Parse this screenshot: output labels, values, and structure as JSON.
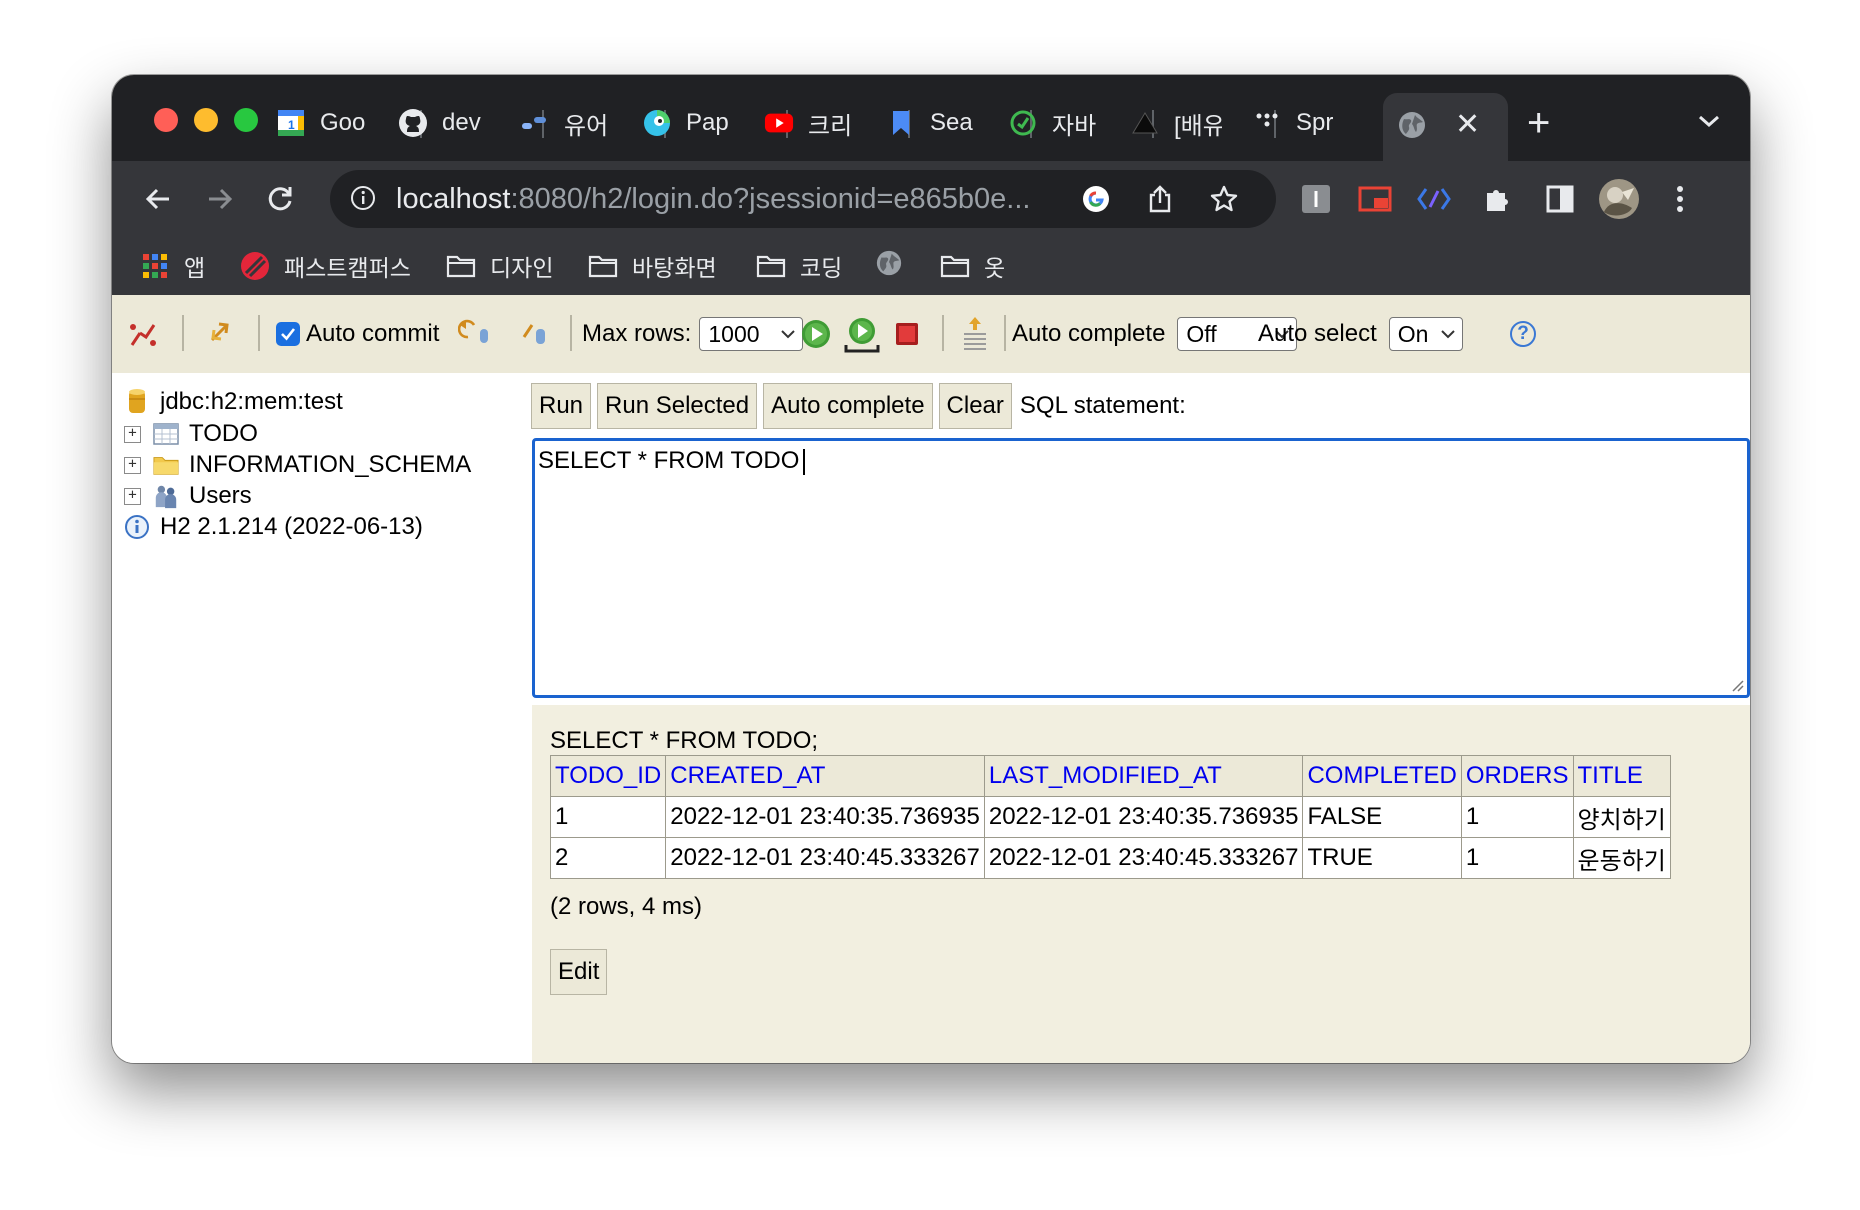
{
  "browser": {
    "tabs": [
      {
        "title": "Goo",
        "icon": "google-calendar-icon"
      },
      {
        "title": "dev",
        "icon": "github-icon"
      },
      {
        "title": "유어",
        "icon": "dash-icon"
      },
      {
        "title": "Pap",
        "icon": "papago-icon"
      },
      {
        "title": "크리",
        "icon": "youtube-icon"
      },
      {
        "title": "Sea",
        "icon": "bookmark-icon"
      },
      {
        "title": "자바",
        "icon": "green-icon"
      },
      {
        "title": "[배유",
        "icon": "triangle-icon"
      },
      {
        "title": "Spr",
        "icon": "dots-icon"
      }
    ],
    "active_tab_icon": "globe-icon",
    "address": {
      "host": "localhost",
      "rest": ":8080/h2/login.do?jsessionid=e865b0e..."
    },
    "bookmarks": [
      {
        "label": "앱",
        "icon": "apps-grid-icon"
      },
      {
        "label": "패스트캠퍼스",
        "icon": "fastcampus-icon"
      },
      {
        "label": "디자인",
        "icon": "folder-icon"
      },
      {
        "label": "바탕화면",
        "icon": "folder-icon"
      },
      {
        "label": "코딩",
        "icon": "folder-icon"
      },
      {
        "label": "",
        "icon": "globe-icon"
      },
      {
        "label": "옷",
        "icon": "folder-icon"
      }
    ]
  },
  "h2toolbar": {
    "auto_commit_label": "Auto commit",
    "auto_commit_checked": true,
    "max_rows_label": "Max rows:",
    "max_rows_value": "1000",
    "auto_complete_label": "Auto complete",
    "auto_complete_value": "Off",
    "auto_select_label": "Auto select",
    "auto_select_value": "On",
    "help_symbol": "?"
  },
  "tree": {
    "connection": "jdbc:h2:mem:test",
    "items": [
      "TODO",
      "INFORMATION_SCHEMA",
      "Users"
    ],
    "version": "H2 2.1.214 (2022-06-13)"
  },
  "editor": {
    "buttons": [
      "Run",
      "Run Selected",
      "Auto complete",
      "Clear"
    ],
    "label": "SQL statement:",
    "sql": "SELECT * FROM TODO"
  },
  "result": {
    "query": "SELECT * FROM TODO;",
    "columns": [
      "TODO_ID",
      "CREATED_AT",
      "LAST_MODIFIED_AT",
      "COMPLETED",
      "ORDERS",
      "TITLE"
    ],
    "rows": [
      [
        "1",
        "2022-12-01 23:40:35.736935",
        "2022-12-01 23:40:35.736935",
        "FALSE",
        "1",
        "양치하기"
      ],
      [
        "2",
        "2022-12-01 23:40:45.333267",
        "2022-12-01 23:40:45.333267",
        "TRUE",
        "1",
        "운동하기"
      ]
    ],
    "summary": "(2 rows, 4 ms)",
    "edit_label": "Edit"
  }
}
